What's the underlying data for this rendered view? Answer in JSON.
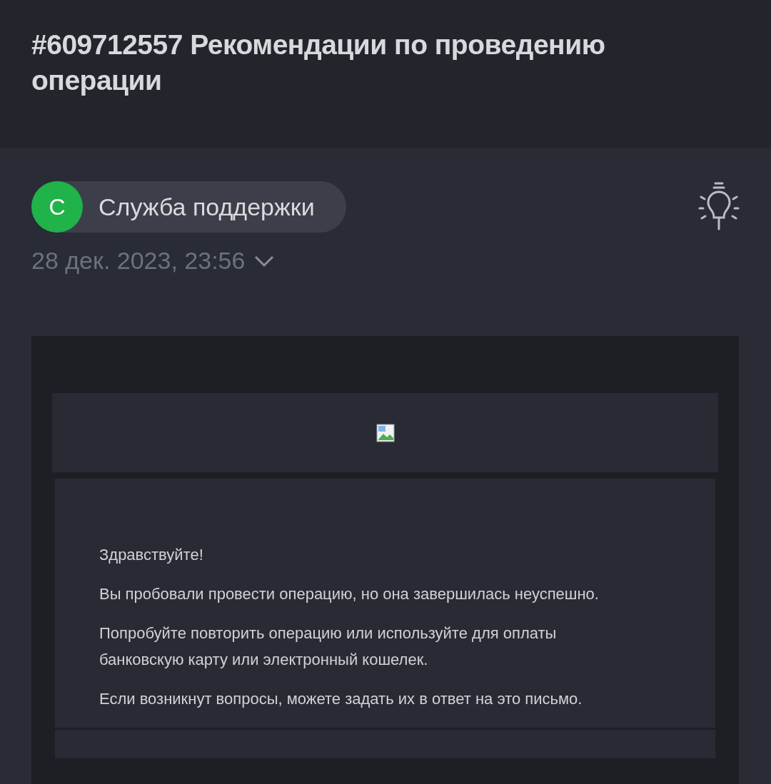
{
  "title": "#609712557 Рекомендации по проведению операции",
  "sender": {
    "initial": "С",
    "name": "Служба поддержки"
  },
  "date": "28 дек. 2023, 23:56",
  "email": {
    "paragraphs": [
      "Здравствуйте!",
      "Вы пробовали провести операцию, но она завершилась неуспешно.",
      "Попробуйте повторить операцию или используйте для оплаты банковскую карту или электронный кошелек.",
      "Если возникнут вопросы, можете задать их в ответ на это письмо."
    ]
  }
}
